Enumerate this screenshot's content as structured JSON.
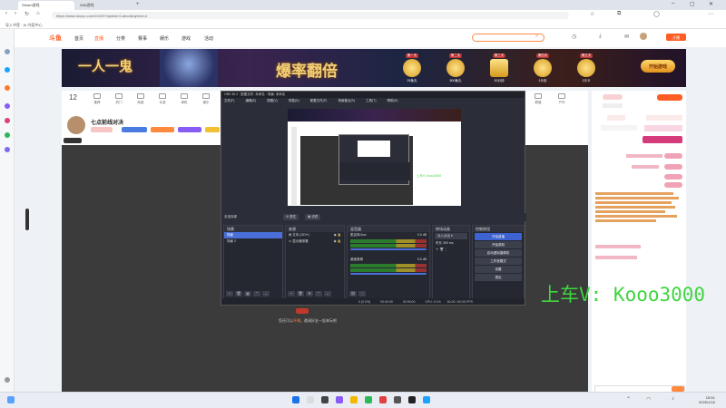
{
  "browser": {
    "tabs": [
      {
        "label": "Steam游戏"
      },
      {
        "label": "Wiki游戏"
      }
    ],
    "url": "https://www.douyu.com/10419?dyshid=0-abcd&dyshci=4",
    "bookmark": "导入书签 · AI 内容中心"
  },
  "site": {
    "logo": "斗鱼",
    "nav": [
      "首页",
      "直播",
      "分类",
      "赛事",
      "娱乐",
      "游戏",
      "活动"
    ],
    "search_placeholder": "",
    "open_stream_label": "开播",
    "banner": {
      "left_text": "一人一鬼",
      "center_text": "爆率翻倍",
      "prizes": [
        {
          "top": "第一天",
          "caption": "25鱼丸"
        },
        {
          "top": "第二天",
          "caption": "500鱼丸"
        },
        {
          "top": "第三天",
          "caption": "30分钟"
        },
        {
          "top": "第四天",
          "caption": "1头衔"
        },
        {
          "top": "第五天",
          "caption": "1天卡"
        }
      ],
      "button": "开始游戏"
    }
  },
  "room": {
    "count": "12",
    "title": "七点前线对决",
    "categories": [
      "推荐",
      "热门",
      "网游",
      "手游",
      "单机",
      "娱乐",
      "颜值",
      "户外"
    ],
    "notice_pre": "您还可以",
    "notice_link": "开播",
    "notice_post": "，邀请好友一起来玩吧"
  },
  "obs": {
    "title": "OBS 30.2 · 配置文件: 未命名 · 场景: 未命名",
    "menu": [
      "文件(F)",
      "编辑(E)",
      "视图(V)",
      "停靠(D)",
      "配置文件(P)",
      "场景集合(S)",
      "工具(T)",
      "帮助(H)"
    ],
    "scene_label": "未选择源",
    "props_btn": "属性",
    "filters_btn": "滤镜",
    "scenes": {
      "title": "场景",
      "items": [
        "场景",
        "场景 2"
      ]
    },
    "sources": {
      "title": "来源",
      "items": [
        "文本 (GDI+)",
        "显示器采集"
      ]
    },
    "mixer": {
      "title": "混音器",
      "channels": [
        {
          "name": "麦克风/Aux",
          "db": "0.0 dB"
        },
        {
          "name": "桌面音频",
          "db": "0.0 dB"
        }
      ]
    },
    "transitions": {
      "title": "转场动画",
      "type": "淡入淡出",
      "duration_label": "时长",
      "duration": "300 ms"
    },
    "controls": {
      "title": "控制按钮",
      "buttons": [
        "开始直播",
        "开始录制",
        "启动虚拟摄像机",
        "工作室模式",
        "设置",
        "退出"
      ]
    },
    "status": {
      "dropped": "0 (0.0%)",
      "time": "00:00:00",
      "cpu": "CPU: 0.1%",
      "fps": "60.00 / 60.00 FPS"
    }
  },
  "overlay": {
    "text": "上车V: Kooo3000"
  },
  "right": {
    "btn1": "送礼物",
    "btn2": "关注"
  },
  "taskbar": {
    "time": "15:51",
    "date": "2025/1/16"
  }
}
